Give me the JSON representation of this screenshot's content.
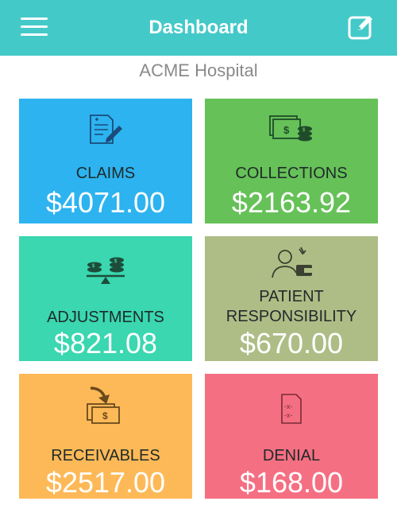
{
  "header": {
    "title": "Dashboard"
  },
  "hospital_name": "ACME Hospital",
  "tiles": [
    {
      "label": "CLAIMS",
      "amount": "$4071.00",
      "color": "#2db3f0",
      "icon": "claim-document-icon"
    },
    {
      "label": "COLLECTIONS",
      "amount": "$2163.92",
      "color": "#66c158",
      "icon": "money-stack-icon"
    },
    {
      "label": "ADJUSTMENTS",
      "amount": "$821.08",
      "color": "#3ad7b0",
      "icon": "balance-scale-icon"
    },
    {
      "label_line1": "PATIENT",
      "label_line2": "RESPONSIBILITY",
      "amount": "$670.00",
      "color": "#aebd86",
      "icon": "patient-payment-icon"
    },
    {
      "label": "RECEIVABLES",
      "amount": "$2517.00",
      "color": "#fdb957",
      "icon": "money-receive-icon"
    },
    {
      "label": "DENIAL",
      "amount": "$168.00",
      "color": "#f56f82",
      "icon": "denial-document-icon"
    }
  ]
}
